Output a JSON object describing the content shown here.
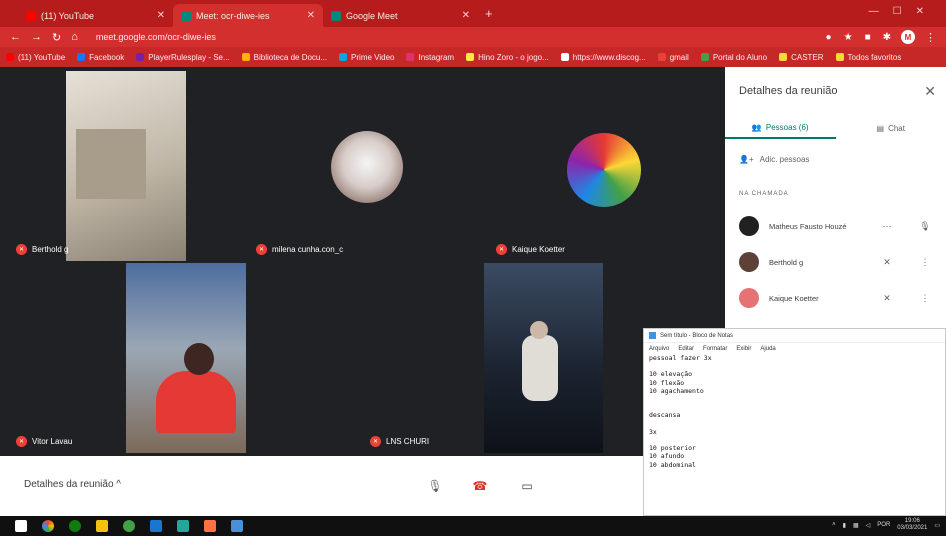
{
  "browser": {
    "tabs": [
      {
        "title": "(11) YouTube",
        "color": "#ff0000"
      },
      {
        "title": "Meet: ocr-diwe-ies",
        "color": "#00897b"
      },
      {
        "title": "Google Meet",
        "color": "#00897b"
      }
    ],
    "url": "meet.google.com/ocr-diwe-ies",
    "bookmarks": [
      "(11) YouTube",
      "Facebook",
      "PlayerRulesplay - Se...",
      "Biblioteca de Docu...",
      "Prime Video",
      "Instagram",
      "Hino Zoro - o jogo...",
      "https://www.discog...",
      "gmail",
      "Portal do Aluno",
      "CASTER",
      "Todos favoritos"
    ]
  },
  "tiles": [
    {
      "name": "Berthold g",
      "bg": "#c8c2b8"
    },
    {
      "name": "milena cunha.con_c",
      "bg": "#202124",
      "avatar_bg": "#d7ccc8"
    },
    {
      "name": "Kaique Koetter",
      "bg": "#202124",
      "avatar_bg": "#26a69a"
    },
    {
      "name": "Vitor Lavau",
      "bg": "#5d6d7e"
    },
    {
      "name": "LNS CHURI",
      "bg": "#2c3e50"
    }
  ],
  "panel": {
    "title": "Detalhes da reunião",
    "tab_people": "Pessoas (6)",
    "tab_chat": "Chat",
    "add_people": "Adic. pessoas",
    "section_label": "NA CHAMADA",
    "people": [
      {
        "name": "Matheus Fausto Houzé",
        "color": "#212121"
      },
      {
        "name": "Berthold g",
        "color": "#5d4037"
      },
      {
        "name": "Kaique Koetter",
        "color": "#e57373"
      }
    ]
  },
  "notepad": {
    "title": "Sem título - Bloco de Notas",
    "menu": [
      "Arquivo",
      "Editar",
      "Formatar",
      "Exibir",
      "Ajuda"
    ],
    "text": "pessoal fazer 3x\n\n10 elevação\n10 flexão\n10 agachamento\n\n\ndescansa\n\n3x\n\n10 posterior\n10 afundo\n10 abdominal"
  },
  "bottom": {
    "meeting_details": "Detalhes da reunião  ^"
  },
  "taskbar": {
    "time": "19:06",
    "date": "03/03/2021",
    "lang": "POR"
  }
}
